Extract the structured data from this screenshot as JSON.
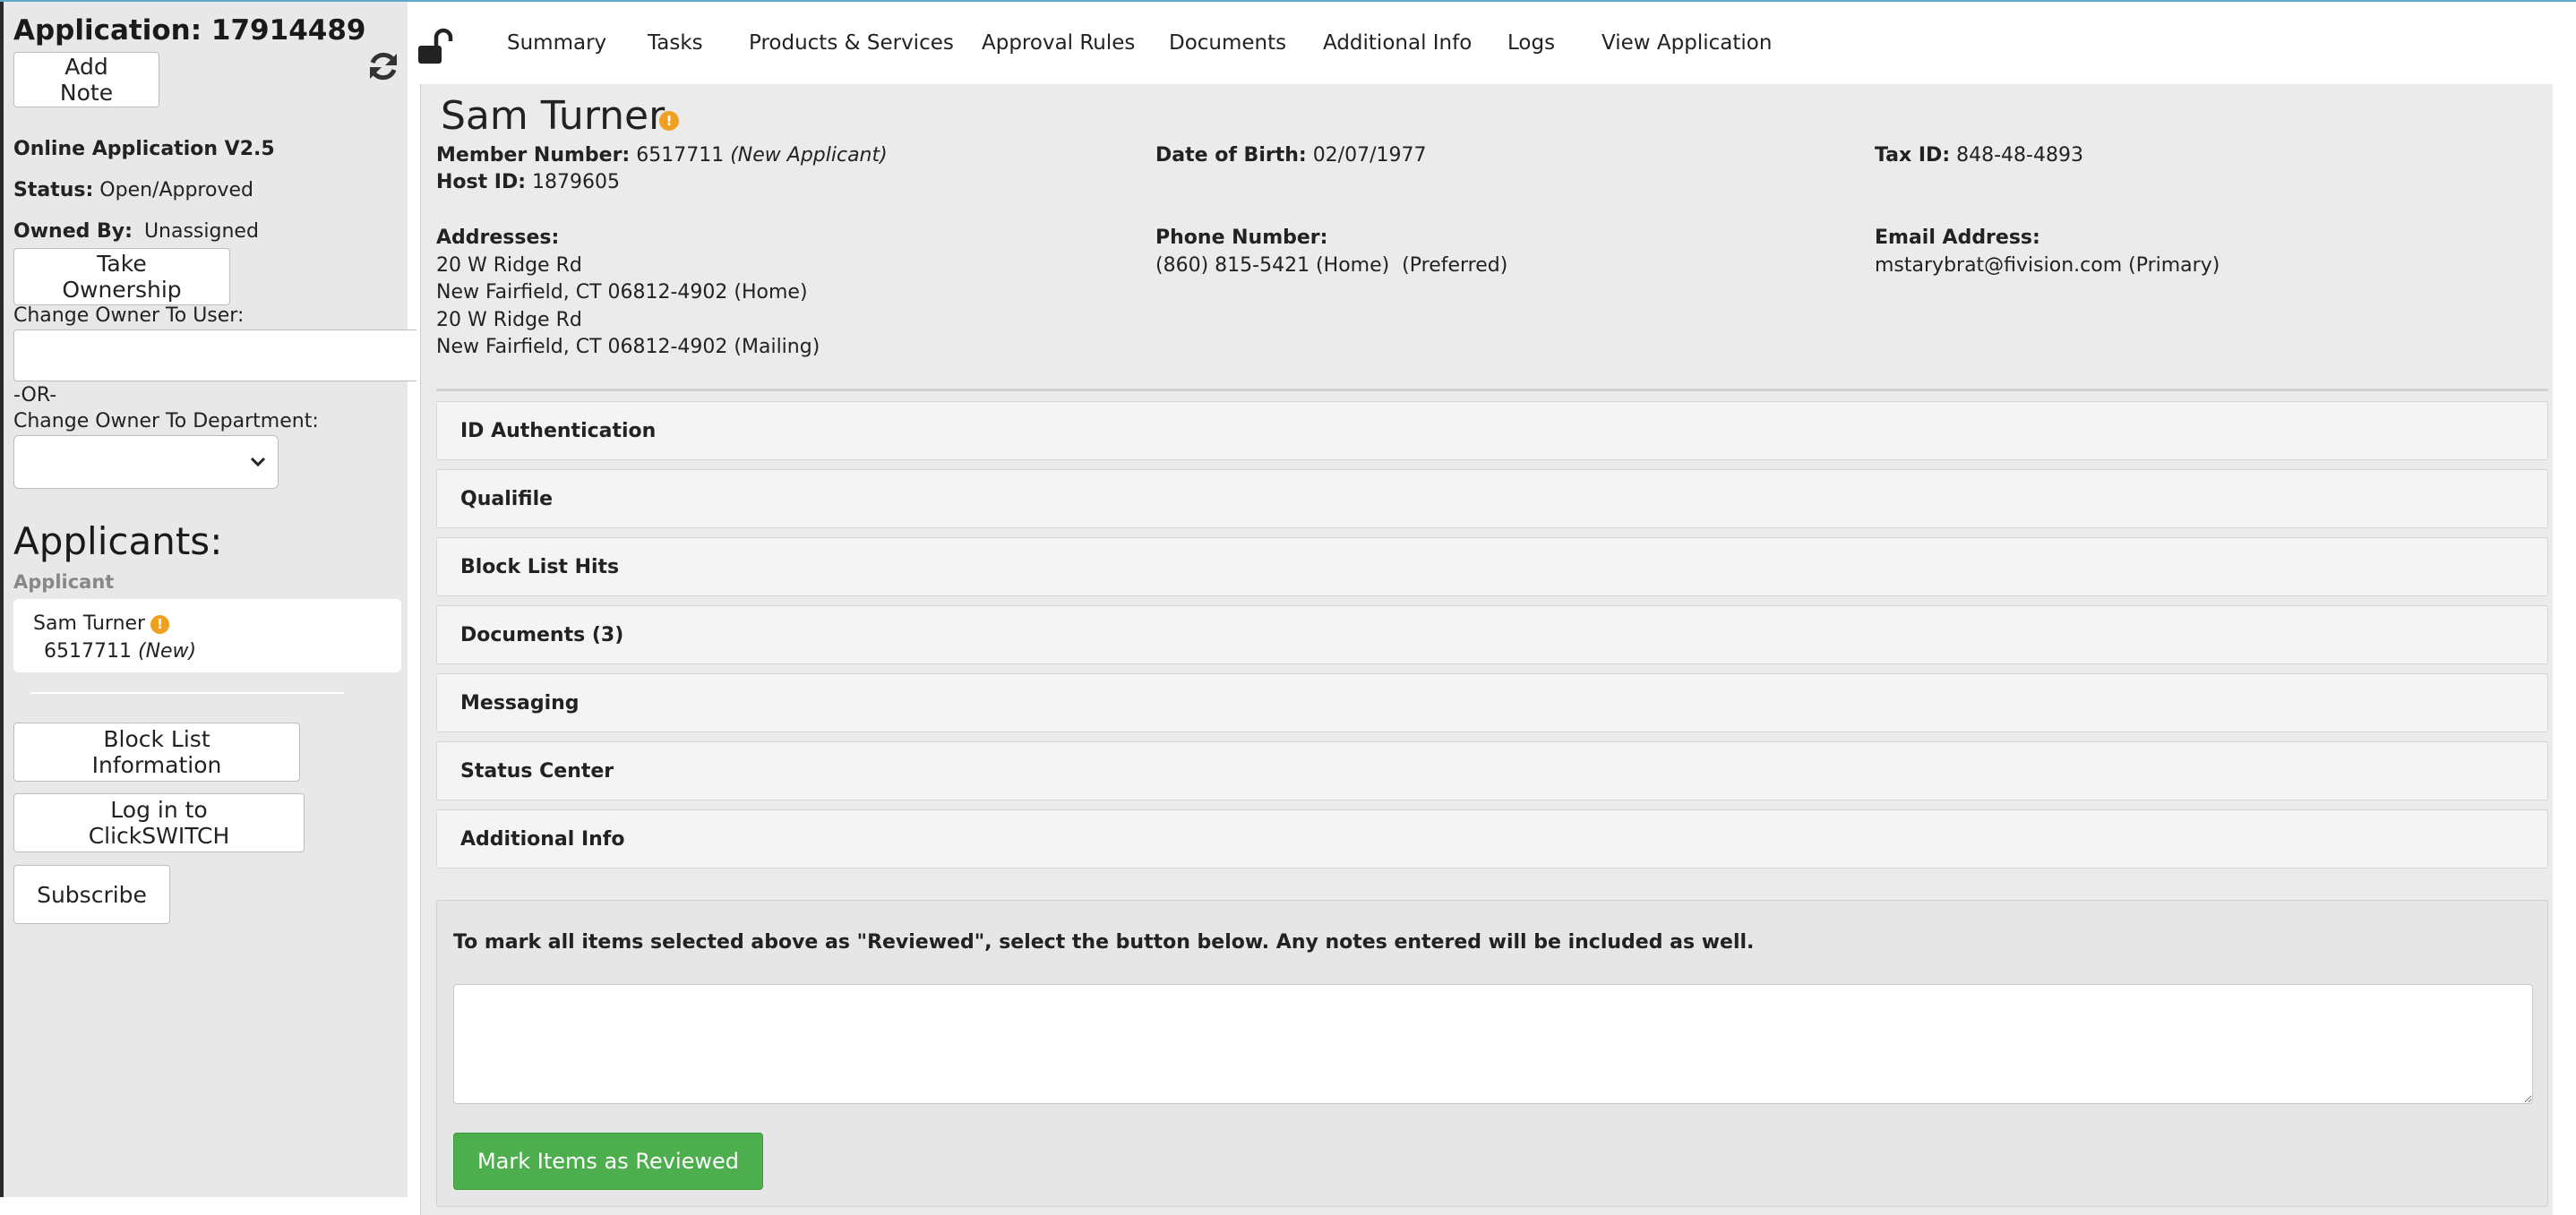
{
  "sidebar": {
    "app_title": "Application: 17914489",
    "add_note_label": "Add Note",
    "app_version": "Online Application V2.5",
    "status_label": "Status:",
    "status_value": "Open/Approved",
    "owned_by_label": "Owned By:",
    "owned_by_value": "Unassigned",
    "take_ownership_label": "Take Ownership",
    "change_owner_user_label": "Change Owner To User:",
    "or_label": "-OR-",
    "change_owner_dept_label": "Change Owner To Department:",
    "dept_selected": "",
    "applicants_heading": "Applicants:",
    "applicant_role": "Applicant",
    "applicant": {
      "name": "Sam Turner",
      "member_number": "6517711",
      "tag": "(New)"
    },
    "buttons": {
      "block_list": "Block List Information",
      "clickswitch": "Log in to ClickSWITCH",
      "subscribe": "Subscribe"
    }
  },
  "nav": {
    "items": [
      "Summary",
      "Tasks",
      "Products & Services",
      "Approval Rules",
      "Documents",
      "Additional Info",
      "Logs",
      "View Application"
    ]
  },
  "member": {
    "name": "Sam Turner",
    "member_number_label": "Member Number:",
    "member_number": "6517711",
    "member_tag": "(New Applicant)",
    "host_id_label": "Host ID:",
    "host_id": "1879605",
    "dob_label": "Date of Birth:",
    "dob": "02/07/1977",
    "tax_id_label": "Tax ID:",
    "tax_id": "848-48-4893",
    "addresses_label": "Addresses:",
    "addresses": [
      "20 W Ridge Rd",
      "New Fairfield, CT 06812-4902 (Home)",
      "20 W Ridge Rd",
      "New Fairfield, CT 06812-4902 (Mailing)"
    ],
    "phone_label": "Phone Number:",
    "phone": "(860) 815-5421 (Home)  (Preferred)",
    "email_label": "Email Address:",
    "email": "mstarybrat@fivision.com (Primary)"
  },
  "sections": [
    "ID Authentication",
    "Qualifile",
    "Block List Hits",
    "Documents (3)",
    "Messaging",
    "Status Center",
    "Additional Info"
  ],
  "review": {
    "instruction": "To mark all items selected above as \"Reviewed\", select the button below. Any notes entered will be included as well.",
    "notes_value": "",
    "button_label": "Mark Items as Reviewed"
  },
  "colors": {
    "accent_green": "#4cae4c",
    "warning_orange": "#f0a020",
    "sidebar_bg": "#e8e8e8",
    "main_bg": "#ebebeb"
  }
}
